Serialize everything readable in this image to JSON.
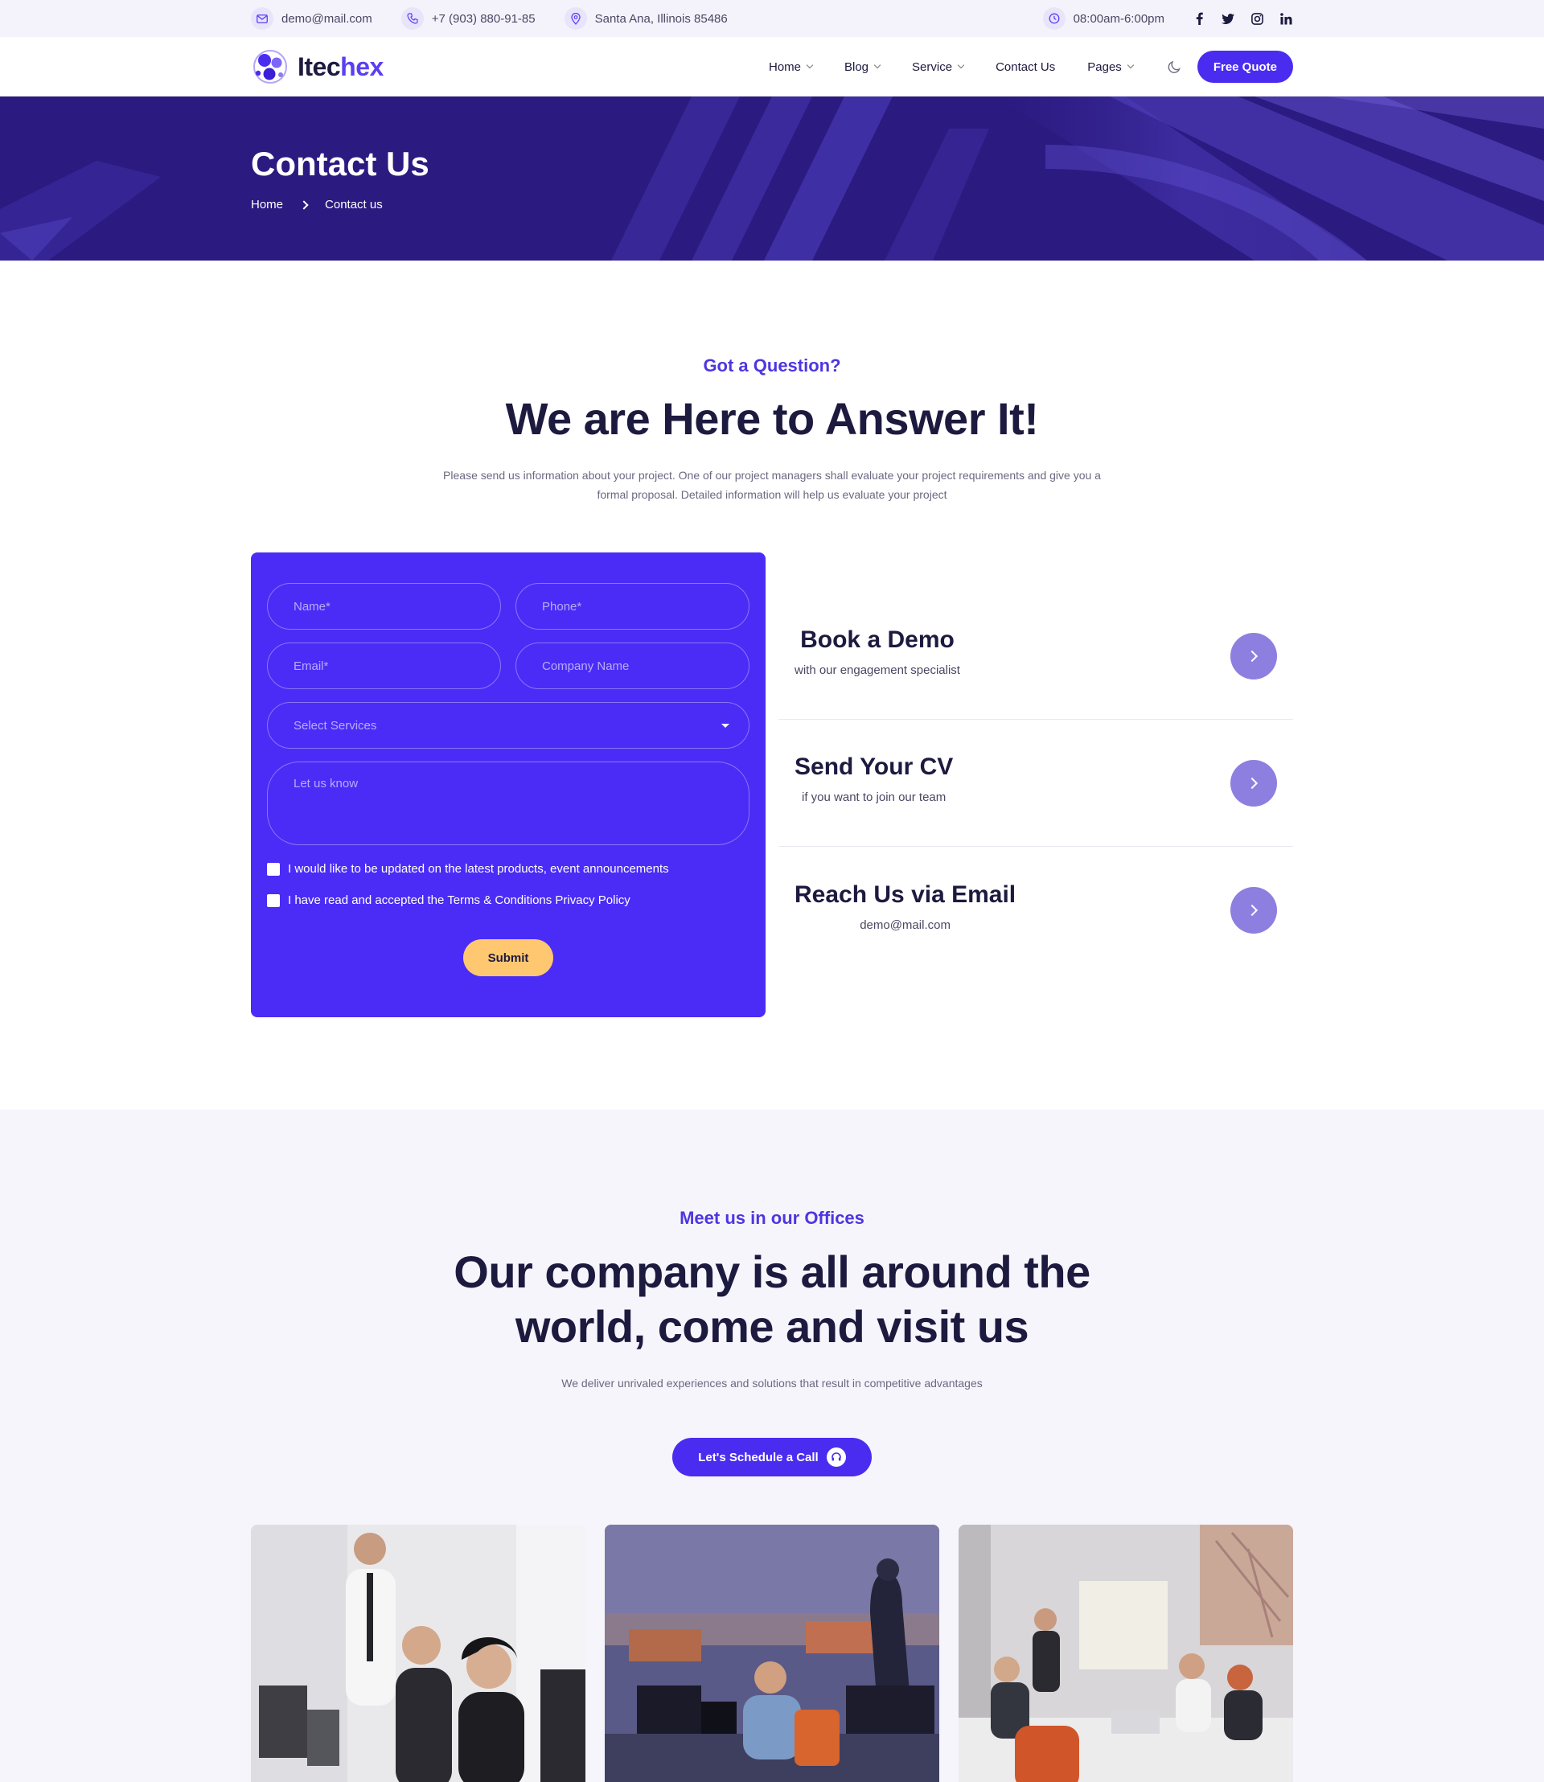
{
  "topbar": {
    "email": "demo@mail.com",
    "phone": "+7 (903) 880-91-85",
    "address": "Santa Ana, Illinois 85486",
    "hours": "08:00am-6:00pm"
  },
  "brand": {
    "name_a": "Itec",
    "name_b": "hex",
    "color": "#4a2cf0"
  },
  "nav": {
    "home": "Home",
    "blog": "Blog",
    "service": "Service",
    "contact": "Contact Us",
    "pages": "Pages",
    "cta": "Free Quote"
  },
  "hero": {
    "title": "Contact Us",
    "crumb_home": "Home",
    "crumb_current": "Contact us"
  },
  "question": {
    "eyebrow": "Got a Question?",
    "title": "We are Here to Answer It!",
    "lead": "Please send us information about your project. One of our project managers shall evaluate your project requirements and give you a formal proposal. Detailed information will help us evaluate your project"
  },
  "form": {
    "name_placeholder": "Name*",
    "phone_placeholder": "Phone*",
    "email_placeholder": "Email*",
    "company_placeholder": "Company Name",
    "select_placeholder": "Select Services",
    "message_placeholder": "Let us know",
    "check_updates": "I would like to be updated on the latest products, event announcements",
    "check_terms": "I have read and accepted the Terms & Conditions Privacy Policy",
    "submit": "Submit"
  },
  "actions": [
    {
      "title": "Book a Demo",
      "subtitle": "with our engagement specialist"
    },
    {
      "title": "Send Your CV",
      "subtitle": "if you want to join our team"
    },
    {
      "title": "Reach Us via Email",
      "subtitle": "demo@mail.com"
    }
  ],
  "offices": {
    "eyebrow": "Meet us in our Offices",
    "title_line1": "Our company is all around the",
    "title_line2": "world, come and visit us",
    "lead": "We deliver unrivaled experiences and solutions that result in competitive advantages",
    "cta": "Let's Schedule a Call"
  },
  "icons": {
    "email": "mail-icon",
    "phone": "phone-icon",
    "address": "map-pin-icon",
    "hours": "clock-icon",
    "social": [
      "facebook-icon",
      "twitter-icon",
      "instagram-icon",
      "linkedin-icon"
    ]
  },
  "colors": {
    "primary": "#4a2cf0",
    "hero": "#2b1a80",
    "accent": "#ffc870",
    "arrow": "#8d7fe0"
  }
}
